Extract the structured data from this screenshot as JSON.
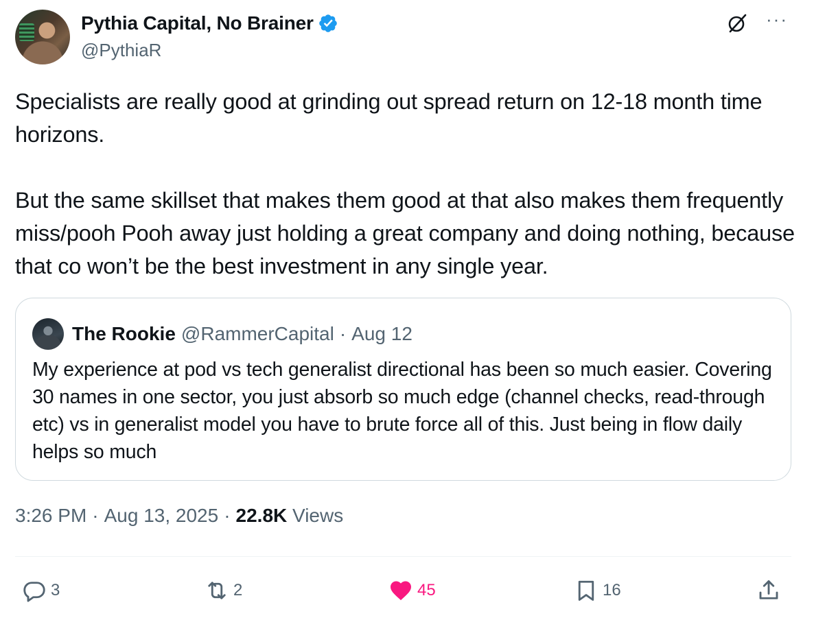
{
  "author": {
    "display_name": "Pythia Capital, No Brainer",
    "handle": "@PythiaR",
    "verified": true,
    "verified_color": "#1d9bf0"
  },
  "top_actions": {
    "more_label": "···"
  },
  "tweet": {
    "paragraph_1": "Specialists are really good at grinding out spread return on 12-18 month time horizons.",
    "paragraph_2": "But the same skillset that makes them good at that also makes them frequently miss/pooh Pooh away just holding a great company and doing nothing, because that co won’t be the best investment in any single year."
  },
  "quote": {
    "display_name": "The Rookie",
    "handle": "@RammerCapital",
    "separator": "·",
    "date": "Aug 12",
    "text": "My experience at pod vs tech generalist directional has been so much easier. Covering 30 names in one sector, you just absorb so much edge (channel checks, read-through etc) vs in generalist model you have to brute force all of this. Just being in flow daily helps so much"
  },
  "meta": {
    "time": "3:26 PM",
    "separator": "·",
    "date": "Aug 13, 2025",
    "views_count": "22.8K",
    "views_label": "Views"
  },
  "actions": {
    "replies": "3",
    "reposts": "2",
    "likes": "45",
    "bookmarks": "16",
    "like_color": "#f91880"
  },
  "icons": [
    "verified-badge-icon",
    "grok-icon",
    "more-icon",
    "reply-icon",
    "repost-icon",
    "heart-icon",
    "bookmark-icon",
    "share-icon"
  ]
}
